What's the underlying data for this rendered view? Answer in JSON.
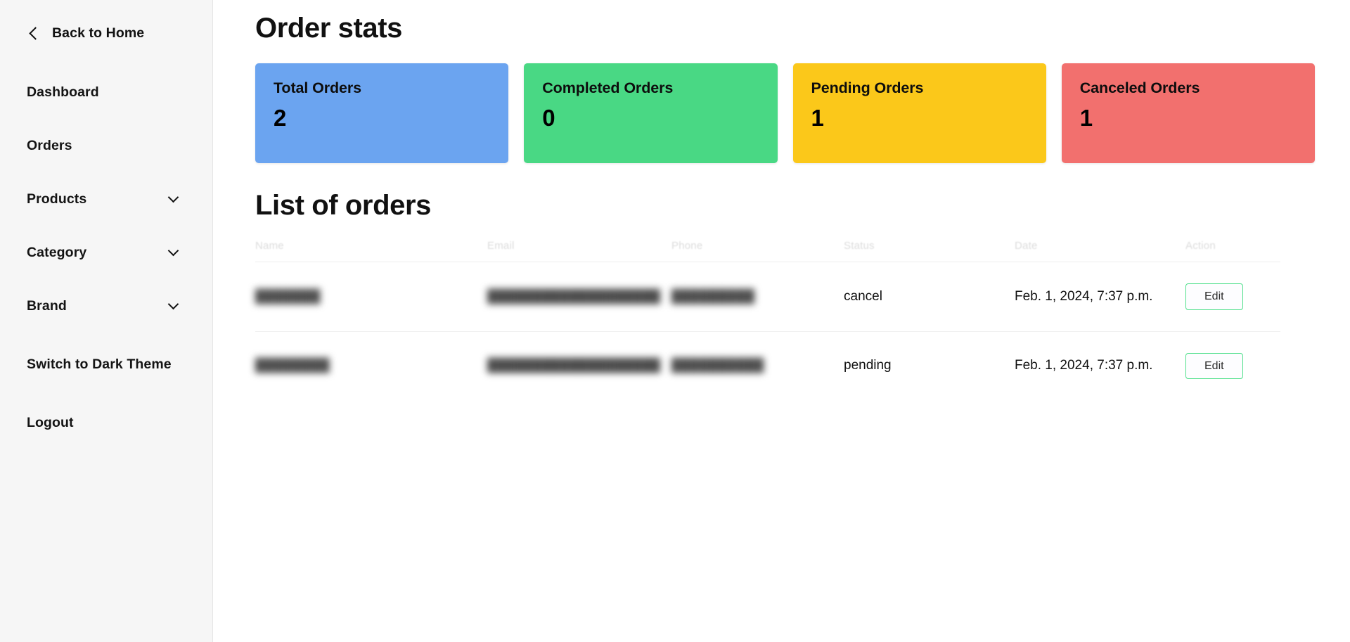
{
  "sidebar": {
    "back": {
      "label": "Back to Home",
      "icon": "chevron-left-icon"
    },
    "items": [
      {
        "label": "Dashboard",
        "expandable": false
      },
      {
        "label": "Orders",
        "expandable": false
      },
      {
        "label": "Products",
        "expandable": true,
        "icon": "chevron-down-icon"
      },
      {
        "label": "Category",
        "expandable": true,
        "icon": "chevron-down-icon"
      },
      {
        "label": "Brand",
        "expandable": true,
        "icon": "chevron-down-icon"
      },
      {
        "label": "Switch to Dark Theme",
        "expandable": false
      },
      {
        "label": "Logout",
        "expandable": false
      }
    ]
  },
  "main": {
    "page_title": "Order stats",
    "section_title": "List of orders",
    "cards": [
      {
        "title": "Total Orders",
        "value": "2",
        "color": "#6ba4f0"
      },
      {
        "title": "Completed Orders",
        "value": "0",
        "color": "#49d884"
      },
      {
        "title": "Pending Orders",
        "value": "1",
        "color": "#fbc81a"
      },
      {
        "title": "Canceled Orders",
        "value": "1",
        "color": "#f2706e"
      }
    ],
    "table": {
      "headers": [
        "Name",
        "Email",
        "Phone",
        "Status",
        "Date",
        "Action"
      ],
      "rows": [
        {
          "name": "███████",
          "email": "███████████████████",
          "phone": "█████████",
          "status": "cancel",
          "date": "Feb. 1, 2024, 7:37 p.m.",
          "action_label": "Edit"
        },
        {
          "name": "████████",
          "email": "███████████████████",
          "phone": "██████████",
          "status": "pending",
          "date": "Feb. 1, 2024, 7:37 p.m.",
          "action_label": "Edit"
        }
      ]
    }
  },
  "theme": {
    "accent_edit_border": "#4ee08a",
    "sidebar_bg": "#f6f6f6",
    "page_bg": "#ffffff"
  }
}
